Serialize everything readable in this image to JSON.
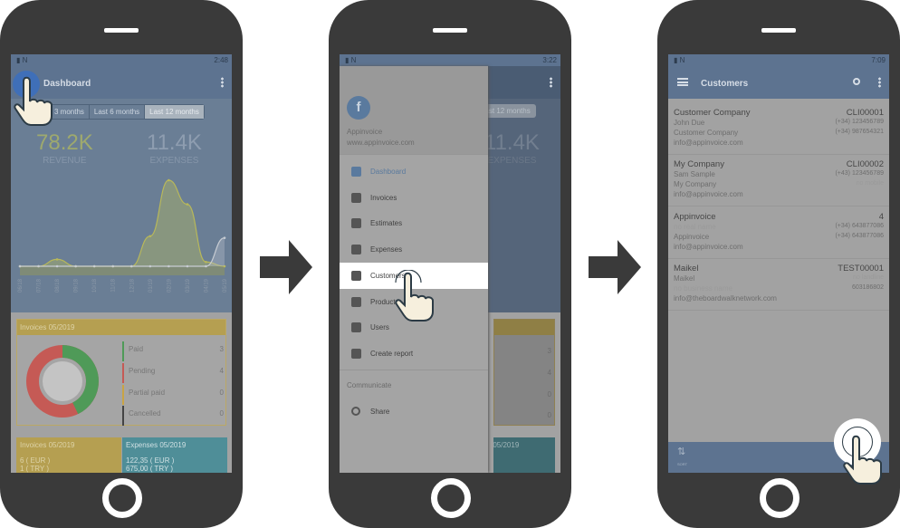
{
  "colors": {
    "appbar": "#5d7390",
    "accent": "#4a78c0",
    "paid": "#4f9a58",
    "pending": "#c55a55",
    "partial": "#c9a445",
    "cancelled": "#444444",
    "expenses_card": "#4f8e98"
  },
  "phone1": {
    "status": {
      "time": "2:48"
    },
    "appbar": {
      "title": "Dashboard",
      "menu_icon": "hamburger-icon",
      "overflow_icon": "more-vert-icon"
    },
    "tabs": [
      "3 months",
      "Last 6 months",
      "Last 12 months"
    ],
    "selected_tab": "Last 12 months",
    "revenue": {
      "value": "78.2K",
      "label": "REVENUE"
    },
    "expenses": {
      "value": "11.4K",
      "label": "EXPENSES"
    },
    "chart_data": {
      "type": "area",
      "x": [
        "06/18",
        "07/18",
        "08/18",
        "09/18",
        "10/18",
        "11/18",
        "12/18",
        "01/19",
        "02/19",
        "03/19",
        "04/19",
        "05/19"
      ],
      "series": [
        {
          "values": [
            0,
            0,
            0.08,
            0,
            0,
            0,
            0,
            0.35,
            1,
            0.72,
            0.05,
            0
          ]
        },
        {
          "values": [
            0,
            0,
            0,
            0,
            0,
            0,
            0,
            0,
            0,
            0,
            0,
            0.33
          ]
        }
      ]
    },
    "invoices_card": {
      "title": "Invoices 05/2019",
      "legend": [
        {
          "label": "Paid",
          "count": "3"
        },
        {
          "label": "Pending",
          "count": "4"
        },
        {
          "label": "Partial paid",
          "count": "0"
        },
        {
          "label": "Cancelled",
          "count": "0"
        }
      ]
    },
    "invoices_total": {
      "title": "Invoices 05/2019",
      "lines": [
        "6 ( EUR )",
        "1 ( TRY )"
      ]
    },
    "expenses_total": {
      "title": "Expenses 05/2019",
      "lines": [
        "122,35 ( EUR )",
        "675,00 ( TRY )"
      ]
    }
  },
  "phone2": {
    "status": {
      "time": "3:22"
    },
    "drawer": {
      "company": "Appinvoice",
      "website": "www.appinvoice.com",
      "logo": "fi",
      "items": [
        {
          "label": "Dashboard",
          "icon": "dashboard-icon"
        },
        {
          "label": "Invoices",
          "icon": "invoice-icon"
        },
        {
          "label": "Estimates",
          "icon": "estimate-icon"
        },
        {
          "label": "Expenses",
          "icon": "coins-icon"
        },
        {
          "label": "Customers",
          "icon": "people-icon"
        },
        {
          "label": "Products",
          "icon": "products-icon"
        },
        {
          "label": "Users",
          "icon": "user-icon"
        },
        {
          "label": "Create report",
          "icon": "report-icon"
        }
      ],
      "section": "Communicate",
      "share": "Share"
    },
    "bg": {
      "tab": "Last 12 months",
      "expenses": "11.4K",
      "expenses_label": "EXPENSES",
      "counts": [
        "3",
        "4",
        "0",
        "0"
      ],
      "card": "Expenses 05/2019"
    }
  },
  "phone3": {
    "status": {
      "time": "7:09"
    },
    "appbar": {
      "title": "Customers"
    },
    "customers": [
      {
        "name": "Customer Company",
        "code": "CLI00001",
        "contact": "John Due",
        "business": "Customer Company",
        "email": "info@appinvoice.com",
        "phone1": "(+34) 123456789",
        "phone2": "(+34) 987654321"
      },
      {
        "name": "My Company",
        "code": "CLI00002",
        "contact": "Sam Sample",
        "business": "My Company",
        "email": "info@appinvoice.com",
        "phone1": "(+43) 123456789",
        "phone2": "no mobile"
      },
      {
        "name": "Appinvoice",
        "code": "4",
        "contact": "no real name",
        "business": "Appinvoice",
        "email": "info@appinvoice.com",
        "phone1": "(+34) 643877086",
        "phone2": "(+34) 643877086"
      },
      {
        "name": "Maikel",
        "code": "TEST00001",
        "contact": "Maikel",
        "business": "no business name",
        "email": "info@theboardwalknetwork.com",
        "phone1": "no landline",
        "phone2": "603186802"
      }
    ],
    "bottom": {
      "sort": "SORT"
    }
  }
}
